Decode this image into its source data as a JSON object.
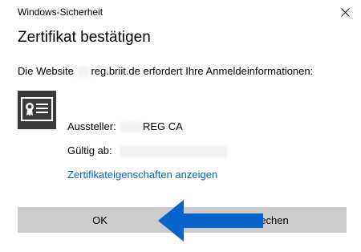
{
  "window": {
    "title": "Windows-Sicherheit",
    "close_icon": "close-icon"
  },
  "dialog": {
    "heading": "Zertifikat bestätigen",
    "message_prefix": "Die Website",
    "message_suffix": "reg.briit.de erfordert Ihre Anmeldeinformationen:",
    "cert_icon": "certificate-icon"
  },
  "certificate": {
    "issuer_label": "Aussteller:",
    "issuer_value": "REG CA",
    "valid_from_label": "Gültig ab:",
    "details_link": "Zertifikateigenschaften anzeigen"
  },
  "buttons": {
    "ok_label": "OK",
    "cancel_label": "rechen"
  },
  "overlay": {
    "arrow_icon": "left-arrow-annotation-icon",
    "arrow_color": "#0a63c9"
  },
  "colors": {
    "link": "#0067c0",
    "button_bg": "#cccccc",
    "icon_bg": "#3a3a3a"
  }
}
